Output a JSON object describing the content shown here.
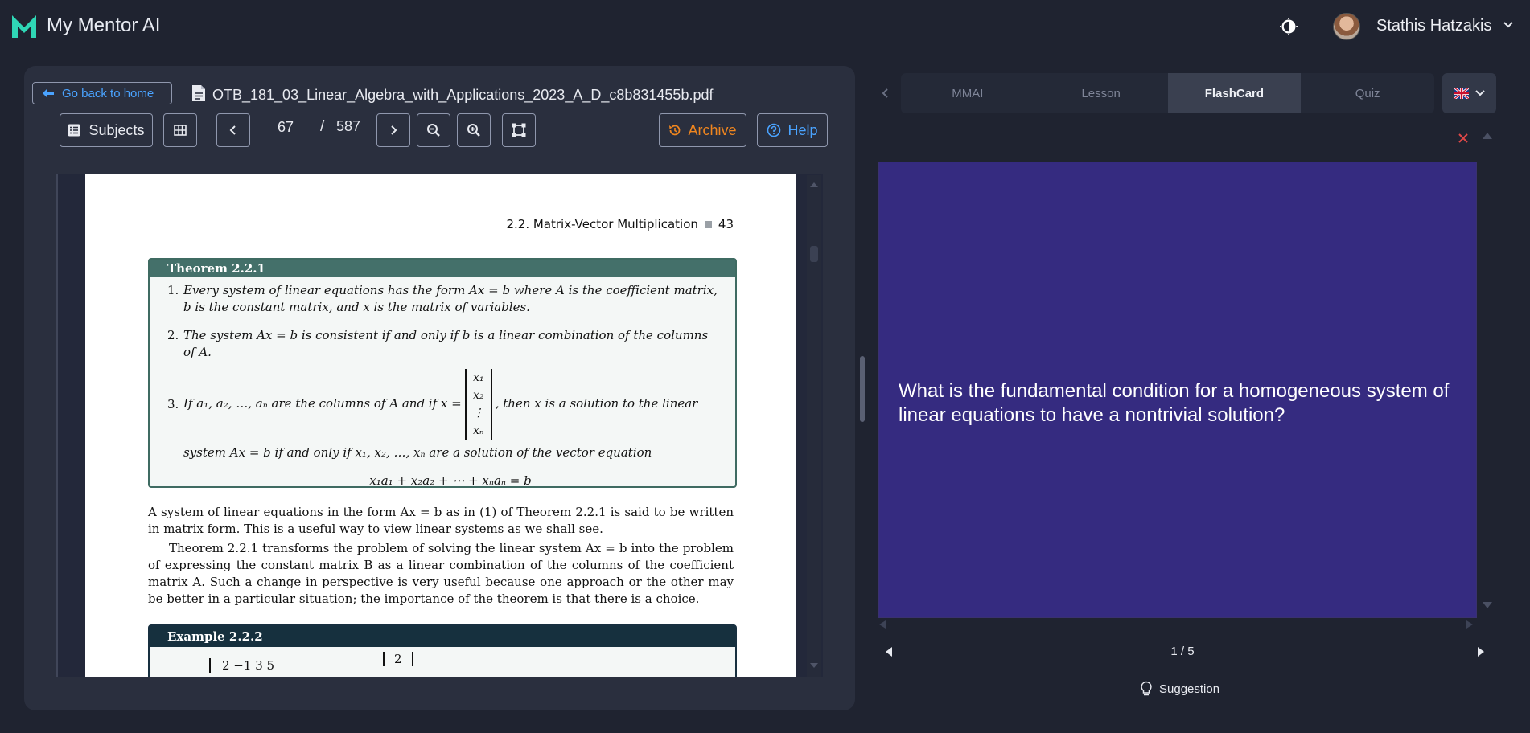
{
  "app": {
    "title": "My Mentor AI",
    "brand_color": "#2fd6b5"
  },
  "user": {
    "name": "Stathis Hatzakis"
  },
  "left": {
    "home_label": "Go back to home",
    "file_name": "OTB_181_03_Linear_Algebra_with_Applications_2023_A_D_c8b831455b.pdf",
    "toolbar": {
      "subjects_label": "Subjects",
      "current_page": "67",
      "separator": "/",
      "total_pages": "587",
      "archive_label": "Archive",
      "help_label": "Help"
    }
  },
  "doc": {
    "running_head": "2.2. Matrix-Vector Multiplication",
    "page_no": "43",
    "theorem_title": "Theorem 2.2.1",
    "item1_n": "1.",
    "item1": "Every system of linear equations has the form Ax = b where A is the coefficient matrix, b is the constant matrix, and x is the matrix of variables.",
    "item2_n": "2.",
    "item2": "The system Ax = b is consistent if and only if b is a linear combination of the columns of A.",
    "item3_n": "3.",
    "item3_a": "If a₁, a₂, …, aₙ are the columns of A and if x =",
    "item3_b": ", then x is a solution to the linear",
    "item3_c": "system Ax = b if and only if x₁, x₂, …, xₙ are a solution of the vector equation",
    "mat_x": [
      "x₁",
      "x₂",
      "⋮",
      "xₙ"
    ],
    "vector_eq": "x₁a₁ + x₂a₂ + ⋯ + xₙaₙ = b",
    "para1": "A system of linear equations in the form Ax = b as in (1) of Theorem 2.2.1 is said to be written in matrix form. This is a useful way to view linear systems as we shall see.",
    "para2": "Theorem 2.2.1 transforms the problem of solving the linear system Ax = b into the problem of expressing the constant matrix B as a linear combination of the columns of the coefficient matrix A. Such a change in perspective is very useful because one approach or the other may be better in a particular situation; the importance of the theorem is that there is a choice.",
    "example_title": "Example 2.2.2",
    "example_row": "2   −1   3   5",
    "example_vec": "2"
  },
  "right": {
    "tabs": [
      {
        "label": "MMAI"
      },
      {
        "label": "Lesson"
      },
      {
        "label": "FlashCard"
      },
      {
        "label": "Quiz"
      }
    ],
    "card_question": "What is the fundamental condition for a homogeneous system of linear equations to have a nontrivial solution?",
    "counter": "1 / 5",
    "suggestion_label": "Suggestion",
    "card_color": "#352b80",
    "close_color": "#e04848"
  },
  "icons": [
    "logo-m-icon",
    "theme-toggle-icon",
    "chevron-down-icon",
    "arrow-left-icon",
    "file-icon",
    "list-icon",
    "grid-icon",
    "chevron-left-icon",
    "chevron-right-icon",
    "zoom-out-icon",
    "zoom-in-icon",
    "fit-page-icon",
    "history-icon",
    "help-circle-icon",
    "close-icon",
    "triangle-up-icon",
    "triangle-down-icon",
    "caret-left-icon",
    "caret-right-icon",
    "lightbulb-icon",
    "uk-flag-icon"
  ]
}
